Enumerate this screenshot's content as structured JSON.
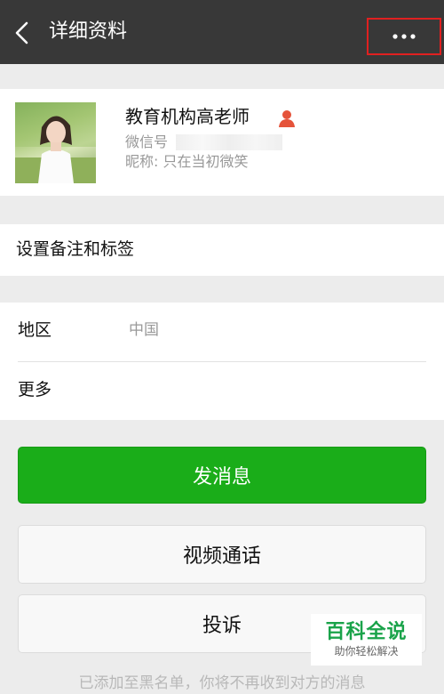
{
  "topbar": {
    "title": "详细资料"
  },
  "profile": {
    "name": "教育机构高老师",
    "wechat_id_label": "微信号",
    "nickname_label": "昵称:",
    "nickname": "只在当初微笑"
  },
  "remark": {
    "label": "设置备注和标签"
  },
  "info": {
    "region_label": "地区",
    "region_value": "中国",
    "more_label": "更多"
  },
  "actions": {
    "send_message": "发消息",
    "video_call": "视频通话",
    "report": "投诉"
  },
  "footer": {
    "note": "已添加至黑名单，你将不再收到对方的消息"
  },
  "watermark": {
    "title": "百科全说",
    "subtitle": "助你轻松解决"
  },
  "colors": {
    "topbar": "#383838",
    "primary": "#1aad19",
    "highlight_box": "#e02020",
    "person_icon": "#e5533a"
  },
  "icons": [
    "back-arrow-icon",
    "more-dots-icon",
    "person-icon"
  ]
}
